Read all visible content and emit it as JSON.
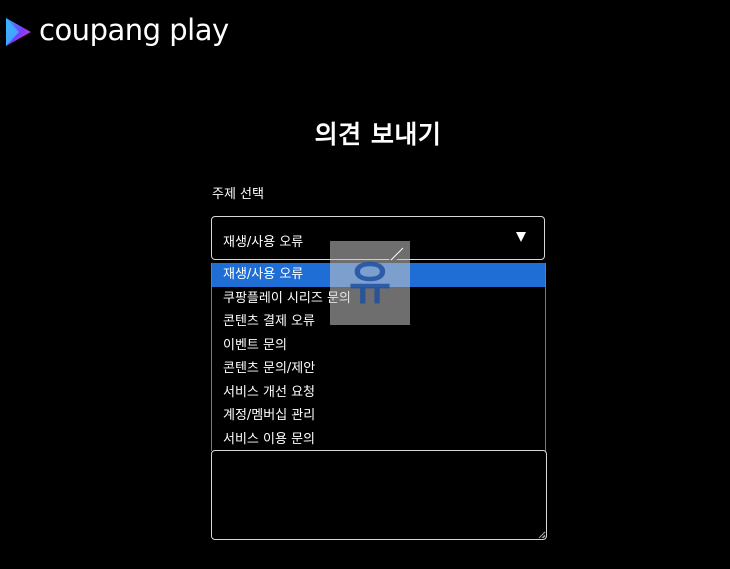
{
  "brand": {
    "name": "coupang play",
    "colors": {
      "gradient_start": "#2ba8ff",
      "gradient_mid": "#7a3cff",
      "gradient_end": "#ff3c8a"
    }
  },
  "page": {
    "title": "의견 보내기"
  },
  "topic": {
    "label": "주제 선택",
    "selected_value": "재생/사용 오류",
    "options": [
      "재생/사용 오류",
      "쿠팡플레이 시리즈 문의",
      "콘텐츠 결제 오류",
      "이벤트 문의",
      "콘텐츠 문의/제안",
      "서비스 개선 요청",
      "계정/멤버십 관리",
      "서비스 이용 문의"
    ],
    "highlighted_index": 0,
    "highlight_color": "#1f6ed6"
  },
  "message": {
    "value": ""
  },
  "watermark": {
    "glyph": "유"
  }
}
